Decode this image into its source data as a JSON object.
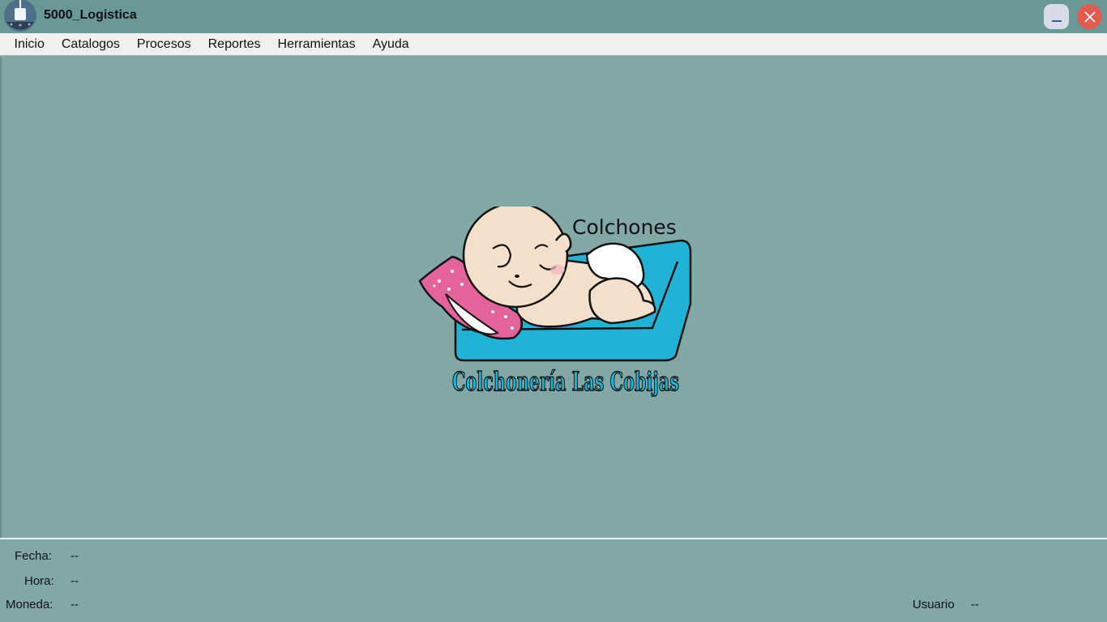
{
  "window": {
    "title": "5000_Logistica",
    "minimize_label": "_",
    "close_label": "✕"
  },
  "menu": {
    "items": [
      "Inicio",
      "Catalogos",
      "Procesos",
      "Reportes",
      "Herramientas",
      "Ayuda"
    ]
  },
  "logo": {
    "top_text": "Colchones",
    "brand_text": "Colchonería Las Cobijas"
  },
  "status": {
    "fecha_label": "Fecha:",
    "fecha_value": "--",
    "hora_label": "Hora:",
    "hora_value": "--",
    "moneda_label": "Moneda:",
    "moneda_value": "--",
    "usuario_label": "Usuario",
    "usuario_value": "--"
  },
  "colors": {
    "titlebar": "#6a9896",
    "background": "#82a8a6",
    "menubar": "#f0f0f0",
    "close_button": "#e55a4e",
    "minimize_button": "#d9dbe6",
    "logo_cushion": "#1fb4d6",
    "logo_pillow": "#e4639a"
  }
}
